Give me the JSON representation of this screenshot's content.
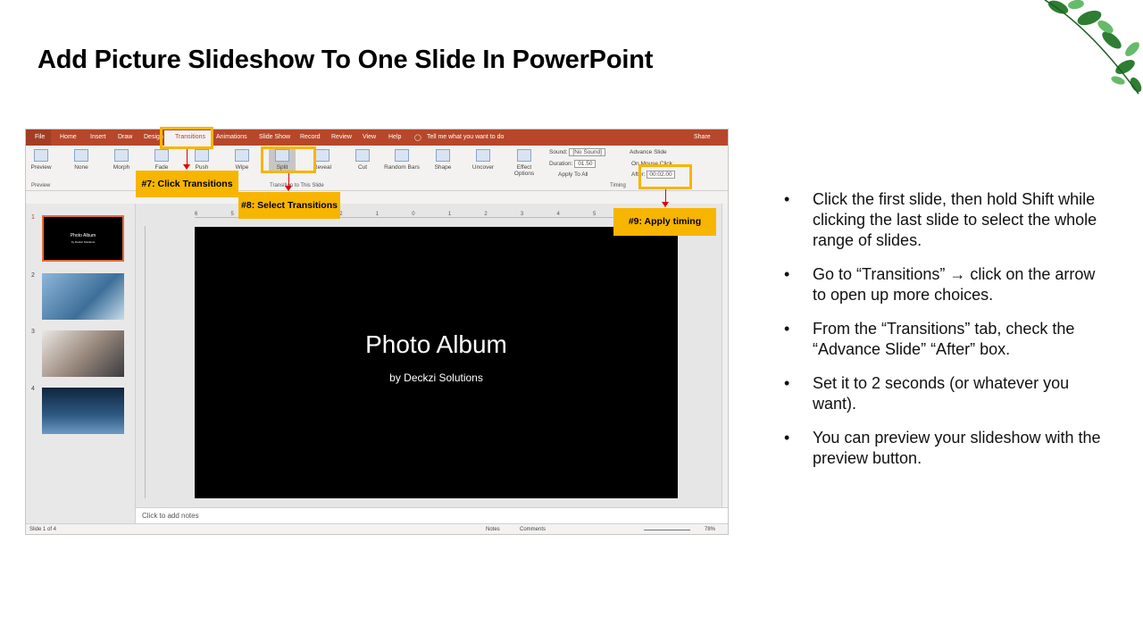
{
  "title": "Add Picture Slideshow To One Slide In PowerPoint",
  "ppt": {
    "tabs": [
      "File",
      "Home",
      "Insert",
      "Draw",
      "Design",
      "Transitions",
      "Animations",
      "Slide Show",
      "Record",
      "Review",
      "View",
      "Help"
    ],
    "tell_me": "Tell me what you want to do",
    "share": "Share",
    "preview_label": "Preview",
    "preview_group": "Preview",
    "transitions": [
      "None",
      "Morph",
      "Fade",
      "Push",
      "Wipe",
      "Split",
      "Reveal",
      "Cut",
      "Random Bars",
      "Shape",
      "Uncover"
    ],
    "effect_options": "Effect Options",
    "transition_group": "Transition to This Slide",
    "sound_label": "Sound:",
    "sound_value": "[No Sound]",
    "duration_label": "Duration:",
    "duration_value": "01.50",
    "apply_all": "Apply To All",
    "advance_slide": "Advance Slide",
    "on_mouse_click": "On Mouse Click",
    "after_label": "After:",
    "after_value": "00:02.00",
    "timing_group": "Timing",
    "ruler_numbers": [
      "6",
      "5",
      "4",
      "3",
      "2",
      "1",
      "0",
      "1",
      "2",
      "3",
      "4",
      "5",
      "6"
    ],
    "slide_title": "Photo Album",
    "slide_subtitle": "by Deckzi Solutions",
    "thumb1_title": "Photo Album",
    "thumb1_sub": "by Deckzi Solutions",
    "slide_numbers": [
      "1",
      "2",
      "3",
      "4"
    ],
    "notes_placeholder": "Click to add notes",
    "status_slide": "Slide 1 of 4",
    "status_notes": "Notes",
    "status_comments": "Comments",
    "zoom": "78%"
  },
  "callouts": {
    "c7": "#7: Click Transitions",
    "c8": "#8: Select Transitions",
    "c9": "#9: Apply timing"
  },
  "steps": [
    "Click the first slide, then hold Shift while clicking the last slide to select the whole range of slides.",
    "Go to “Transitions” → click on the arrow to open up more choices.",
    "From the “Transitions” tab, check the “Advance Slide” “After” box.",
    "Set it to 2 seconds (or whatever you want).",
    "You can preview your slideshow with the preview button."
  ],
  "bullet": "•",
  "colors": {
    "accent": "#b7472a",
    "callout": "#f7b500",
    "arrow": "#e00000"
  }
}
